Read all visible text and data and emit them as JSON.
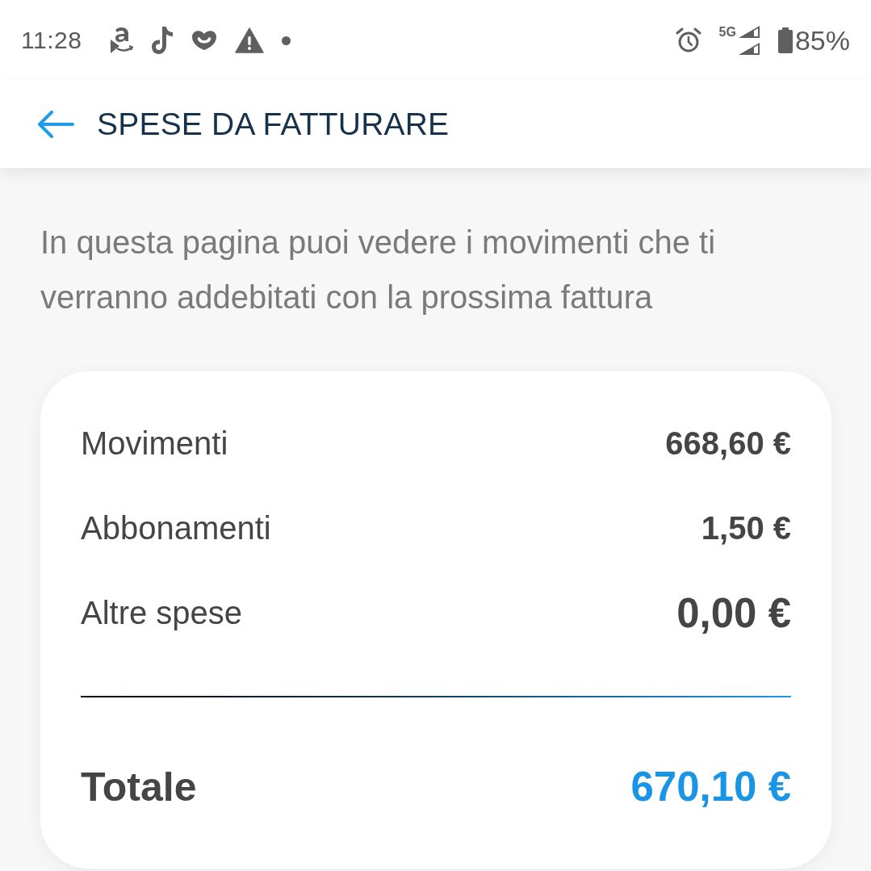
{
  "status_bar": {
    "time": "11:28",
    "network": "5G",
    "battery": "85%"
  },
  "header": {
    "title": "SPESE DA FATTURARE"
  },
  "intro": "In questa pagina puoi vedere i movimenti che ti verranno addebitati con la prossima fattura",
  "summary": {
    "rows": [
      {
        "label": "Movimenti",
        "value": "668,60 €",
        "kind": "normal"
      },
      {
        "label": "Abbonamenti",
        "value": "1,50 €",
        "kind": "normal"
      },
      {
        "label": "Altre spese",
        "value": "0,00 €",
        "kind": "large"
      }
    ],
    "total": {
      "label": "Totale",
      "value": "670,10 €"
    }
  }
}
